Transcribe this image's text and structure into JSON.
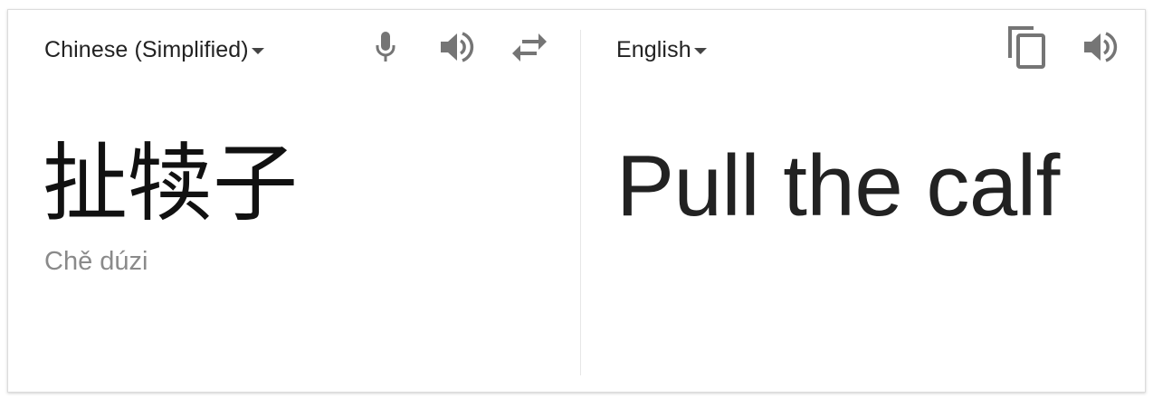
{
  "source": {
    "language": "Chinese (Simplified)",
    "text": "扯犊子",
    "romanization": "Chě dúzi"
  },
  "target": {
    "language": "English",
    "text": "Pull the calf"
  },
  "icons": {
    "mic": "microphone-icon",
    "speak_source": "speaker-icon",
    "swap": "swap-languages-icon",
    "copy": "copy-icon",
    "speak_target": "speaker-icon"
  },
  "colors": {
    "icon": "#757575",
    "text": "#222222",
    "romanization": "#8a8a8a",
    "divider": "#e6e6e6"
  }
}
